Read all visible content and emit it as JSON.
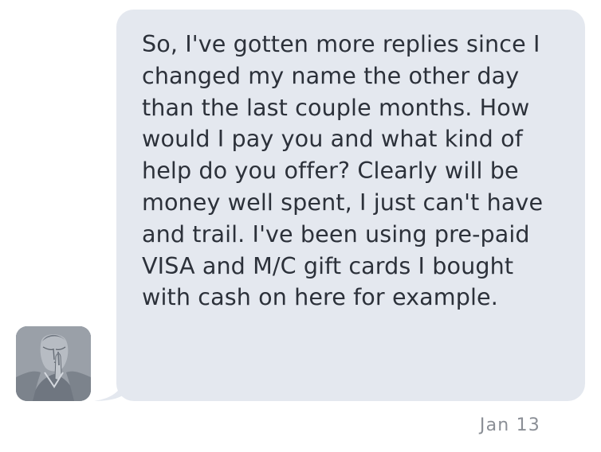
{
  "conversation": {
    "message": {
      "text": "So, I've gotten more replies since I changed my name the other day than the last couple months. How would I pay you and what kind of help do you offer? Clearly will be money well spent, I just can't have and trail. I've been using pre-paid VISA and M/C gift cards I bought with cash on here for example.",
      "timestamp": "Jan 13"
    },
    "avatar_icon": "person-shush-avatar-icon"
  },
  "colors": {
    "bubble": "#e4e8ef",
    "text": "#2c313a",
    "timestamp": "#8b8f96",
    "avatar": "#8f959f"
  }
}
